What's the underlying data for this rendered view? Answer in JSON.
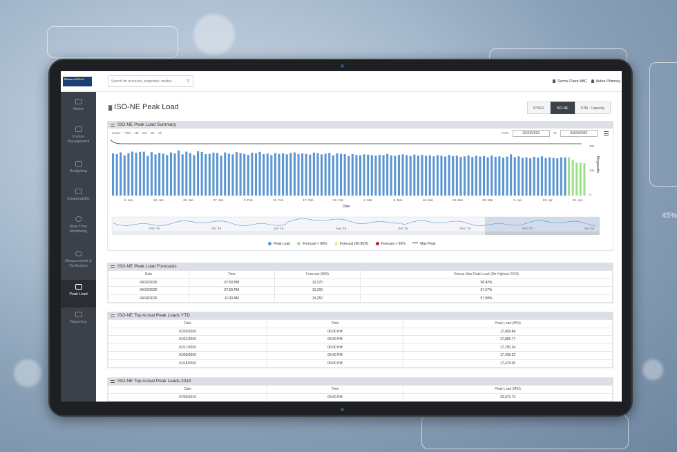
{
  "topbar": {
    "logo_text": "Balanced Rock",
    "search_placeholder": "Search for accounts, properties, modes...",
    "client_label": "Demo Client ABC",
    "user_label": "Aiden Phinney"
  },
  "sidebar": {
    "items": [
      {
        "label": "Home"
      },
      {
        "label": "Invoice Management"
      },
      {
        "label": "Budgeting"
      },
      {
        "label": "Sustainability"
      },
      {
        "label": "Real-Time Monitoring"
      },
      {
        "label": "Measurement & Verification"
      },
      {
        "label": "Peak Load"
      },
      {
        "label": "Reporting"
      }
    ]
  },
  "page": {
    "title": "ISO-NE Peak Load",
    "tabs": [
      "NYISO",
      "ISO-NE",
      "PJM - Capacity"
    ],
    "active_tab": "ISO-NE"
  },
  "summary": {
    "header": "ISO-NE Peak Load Summary",
    "zoom_label": "Zoom",
    "zoom_options": [
      "YTD",
      "1M",
      "1W",
      "1D",
      "All"
    ],
    "from_label": "From",
    "from_date": "12/31/2019",
    "to_label": "To",
    "to_date": "04/24/2020",
    "navigator_labels": [
      "Feb '19",
      "Apr '19",
      "Jun '19",
      "Aug '19",
      "Oct '19",
      "Dec '19",
      "Feb '20",
      "Apr '20"
    ]
  },
  "colors": {
    "peak_load": "#5b95d2",
    "forecast_lt_90": "#9be08a",
    "forecast_90_95": "#f3e58a",
    "forecast_gt_95": "#b22222",
    "max_peak": "#333333"
  },
  "chart_data": {
    "type": "bar",
    "xlabel": "Date",
    "ylabel": "Megawatts",
    "ylim": [
      0,
      20
    ],
    "y_ticks": [
      "20k",
      "10k",
      "0"
    ],
    "x_ticks": [
      "6. Jan",
      "13. Jan",
      "20. Jan",
      "27. Jan",
      "3. Feb",
      "10. Feb",
      "17. Feb",
      "24. Feb",
      "2. Mar",
      "9. Mar",
      "16. Mar",
      "23. Mar",
      "30. Mar",
      "6. Apr",
      "13. Apr",
      "20. Apr"
    ],
    "legend_position": "bottom",
    "series": [
      {
        "name": "Peak Load",
        "values": [
          17.2,
          16.9,
          17.6,
          16.4,
          17.3,
          17.9,
          17.5,
          17.8,
          17.9,
          16.2,
          17.7,
          16.8,
          17.4,
          17.1,
          16.6,
          17.6,
          17.2,
          18.4,
          16.8,
          17.9,
          17.3,
          16.5,
          18.1,
          17.8,
          16.9,
          17.0,
          17.5,
          17.4,
          16.3,
          17.6,
          17.1,
          16.8,
          17.7,
          17.3,
          17.0,
          16.6,
          17.5,
          17.2,
          17.8,
          16.9,
          17.1,
          16.5,
          17.3,
          17.0,
          17.2,
          16.8,
          17.4,
          17.6,
          16.9,
          17.2,
          17.0,
          16.7,
          17.5,
          17.3,
          16.8,
          17.1,
          17.4,
          16.4,
          17.2,
          17.0,
          16.9,
          16.2,
          16.9,
          16.6,
          16.4,
          16.8,
          16.7,
          16.5,
          16.3,
          16.6,
          16.5,
          16.9,
          16.4,
          16.2,
          16.6,
          16.8,
          16.5,
          16.1,
          16.7,
          16.3,
          16.6,
          16.2,
          16.4,
          16.0,
          16.5,
          16.2,
          15.9,
          16.6,
          16.1,
          16.3,
          15.8,
          16.0,
          16.4,
          15.7,
          16.2,
          15.9,
          16.1,
          15.6,
          16.3,
          15.8,
          16.0,
          15.5,
          15.9,
          16.8,
          15.7,
          16.0,
          15.4,
          15.6,
          15.2,
          15.8,
          15.5,
          16.0,
          15.3,
          15.6,
          15.4,
          15.2,
          15.6,
          15.5
        ]
      },
      {
        "name": "Forecast < 90%",
        "values": [
          15.6,
          14.5,
          13.4,
          13.4,
          13.2
        ]
      },
      {
        "name": "Forecast (90-95)%",
        "values": []
      },
      {
        "name": "Forecast > 95%",
        "values": []
      },
      {
        "name": "Max Peak",
        "values": [
          23.97
        ]
      }
    ]
  },
  "forecasts": {
    "header": "ISO-NE Peak Load Forecasts",
    "columns": [
      "Date",
      "Time",
      "Forecast (MW)",
      "Versus Max Peak Load (5th Highest 2019)"
    ],
    "rows": [
      [
        "04/22/2020",
        "07:00 PM",
        "13,370",
        "58.42%"
      ],
      [
        "04/23/2020",
        "07:00 PM",
        "13,200",
        "57.67%"
      ],
      [
        "04/24/2020",
        "11:00 AM",
        "13,250",
        "57.89%"
      ]
    ]
  },
  "ytd": {
    "header": "ISO-NE Top Actual Peak Loads YTD",
    "columns": [
      "Date",
      "Time",
      "Peak Load (MW)"
    ],
    "rows": [
      [
        "01/20/2020",
        "06:00 PM",
        "17,909.84"
      ],
      [
        "01/21/2020",
        "06:00 PM",
        "17,895.77"
      ],
      [
        "01/17/2020",
        "06:00 PM",
        "17,750.34"
      ],
      [
        "01/09/2020",
        "06:00 PM",
        "17,493.22"
      ],
      [
        "01/18/2020",
        "06:00 PM",
        "17,479.06"
      ]
    ]
  },
  "y2019": {
    "header": "ISO-NE Top Actual Peak Loads 2019",
    "columns": [
      "Date",
      "Time",
      "Peak Load (MW)"
    ],
    "rows": [
      [
        "07/30/2019",
        "05:00 PM",
        "23,972.73"
      ]
    ]
  }
}
